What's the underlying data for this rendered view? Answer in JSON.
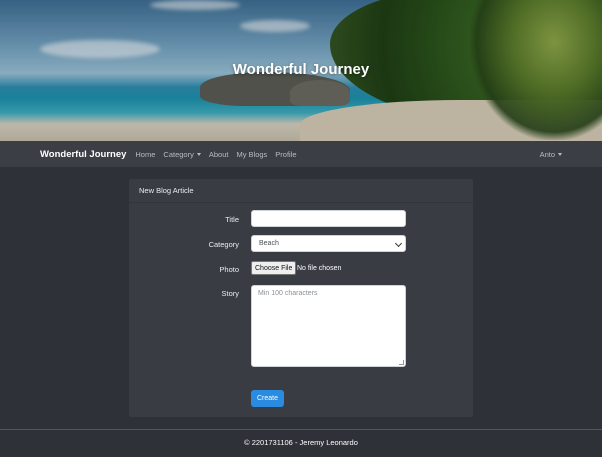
{
  "hero": {
    "title": "Wonderful Journey"
  },
  "navbar": {
    "brand": "Wonderful Journey",
    "links": [
      "Home",
      "Category",
      "About",
      "My Blogs",
      "Profile"
    ],
    "user": "Anto"
  },
  "card": {
    "header": "New Blog Article",
    "fields": {
      "title_label": "Title",
      "title_value": "",
      "category_label": "Category",
      "category_selected": "Beach",
      "photo_label": "Photo",
      "photo_button": "Choose File",
      "photo_status": "No file chosen",
      "story_label": "Story",
      "story_placeholder": "Min 100 characters"
    },
    "submit_label": "Create"
  },
  "footer": {
    "text": "© 2201731106 - Jeremy Leonardo"
  },
  "colors": {
    "accent": "#2b8be0",
    "background": "#2e3138",
    "navbar": "#3b3e45",
    "card": "#393c43"
  }
}
